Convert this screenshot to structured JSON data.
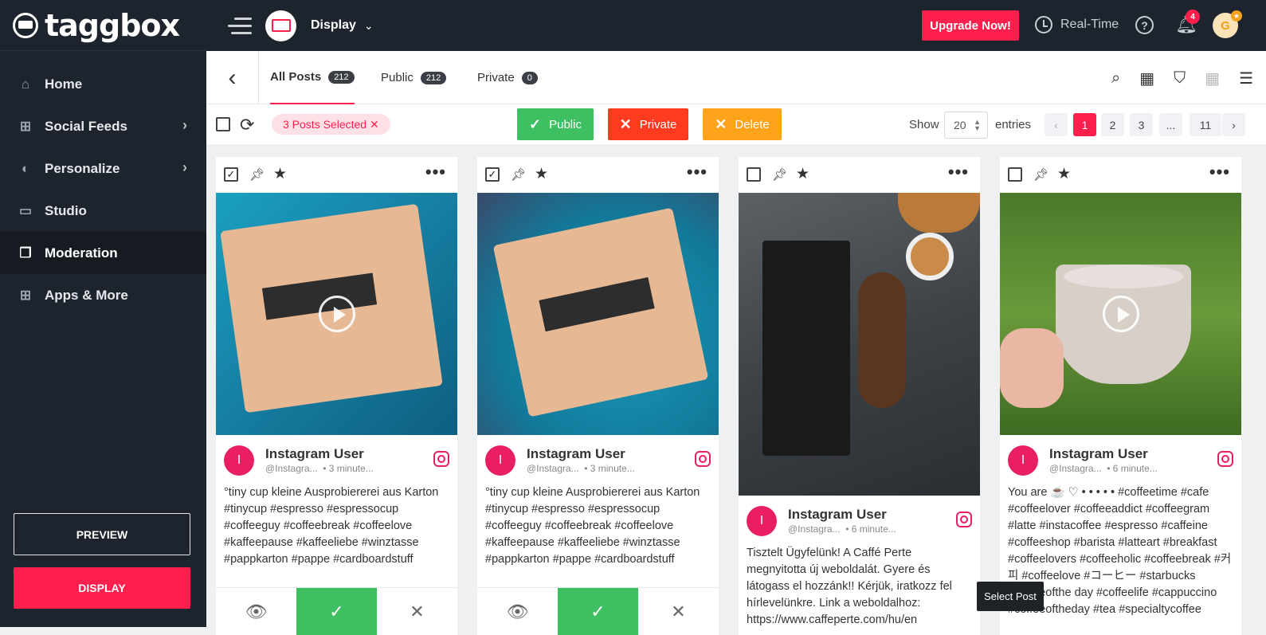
{
  "brand": {
    "name": "taggbox"
  },
  "sidebar": {
    "items": [
      {
        "label": "Home",
        "icon": "home-icon"
      },
      {
        "label": "Social Feeds",
        "icon": "add-feed-icon",
        "chevron": true
      },
      {
        "label": "Personalize",
        "icon": "drop-icon",
        "chevron": true
      },
      {
        "label": "Studio",
        "icon": "monitor-icon"
      },
      {
        "label": "Moderation",
        "icon": "moderation-icon",
        "active": true
      },
      {
        "label": "Apps & More",
        "icon": "apps-icon"
      }
    ],
    "preview_label": "PREVIEW",
    "display_label": "DISPLAY"
  },
  "topbar": {
    "display_label": "Display",
    "upgrade_label": "Upgrade Now!",
    "realtime_label": "Real-Time",
    "notifications": "4",
    "avatar_initial": "G"
  },
  "tabs": [
    {
      "label": "All Posts",
      "count": "212"
    },
    {
      "label": "Public",
      "count": "212"
    },
    {
      "label": "Private",
      "count": "0"
    }
  ],
  "actions": {
    "selected_text": "3  Posts Selected ✕",
    "public_label": "Public",
    "private_label": "Private",
    "delete_label": "Delete",
    "show_label": "Show",
    "entries_value": "20",
    "entries_label": "entries",
    "pages": [
      "1",
      "2",
      "3",
      "...",
      "11"
    ],
    "prev": "‹",
    "next": "›"
  },
  "posts": [
    {
      "user": "Instagram User",
      "handle": "@Instagra...",
      "time": "• 3 minute...",
      "text": "°tiny cup kleine Ausprobiererei aus Karton #tinycup #espresso #espressocup #coffeeguy #coffeebreak #coffeelove #kaffeepause #kaffeeliebe #winztasse #pappkarton #pappe #cardboardstuff",
      "checked": true
    },
    {
      "user": "Instagram User",
      "handle": "@Instagra...",
      "time": "• 3 minute...",
      "text": "°tiny cup kleine Ausprobiererei aus Karton #tinycup #espresso #espressocup #coffeeguy #coffeebreak #coffeelove #kaffeepause #kaffeeliebe #winztasse #pappkarton #pappe #cardboardstuff",
      "checked": true
    },
    {
      "user": "Instagram User",
      "handle": "@Instagra...",
      "time": "• 6 minute...",
      "text": "Tisztelt Ügyfelünk! A Caffé Perte megnyitotta új weboldalát. Gyere és látogass el hozzánk!! Kérjük, iratkozz fel hírlevelünkre. Link a weboldalhoz: https://www.caffeperte.com/hu/en",
      "checked": false
    },
    {
      "user": "Instagram User",
      "handle": "@Instagra...",
      "time": "• 6 minute...",
      "text": "You are ☕ ♡ • • • • • #coffeetime #cafe #coffeelover #coffeeaddict #coffeegram #latte #instacoffee #espresso #caffeine #coffeeshop #barista #latteart #breakfast #coffeelovers #coffeeholic #coffeebreak #커피 #coffeelove #コーヒー #starbucks #coffeeofthe day #coffeelife #cappuccino #coffeeoftheday #tea #specialtycoffee",
      "checked": false
    }
  ],
  "tooltip": "Select Post"
}
